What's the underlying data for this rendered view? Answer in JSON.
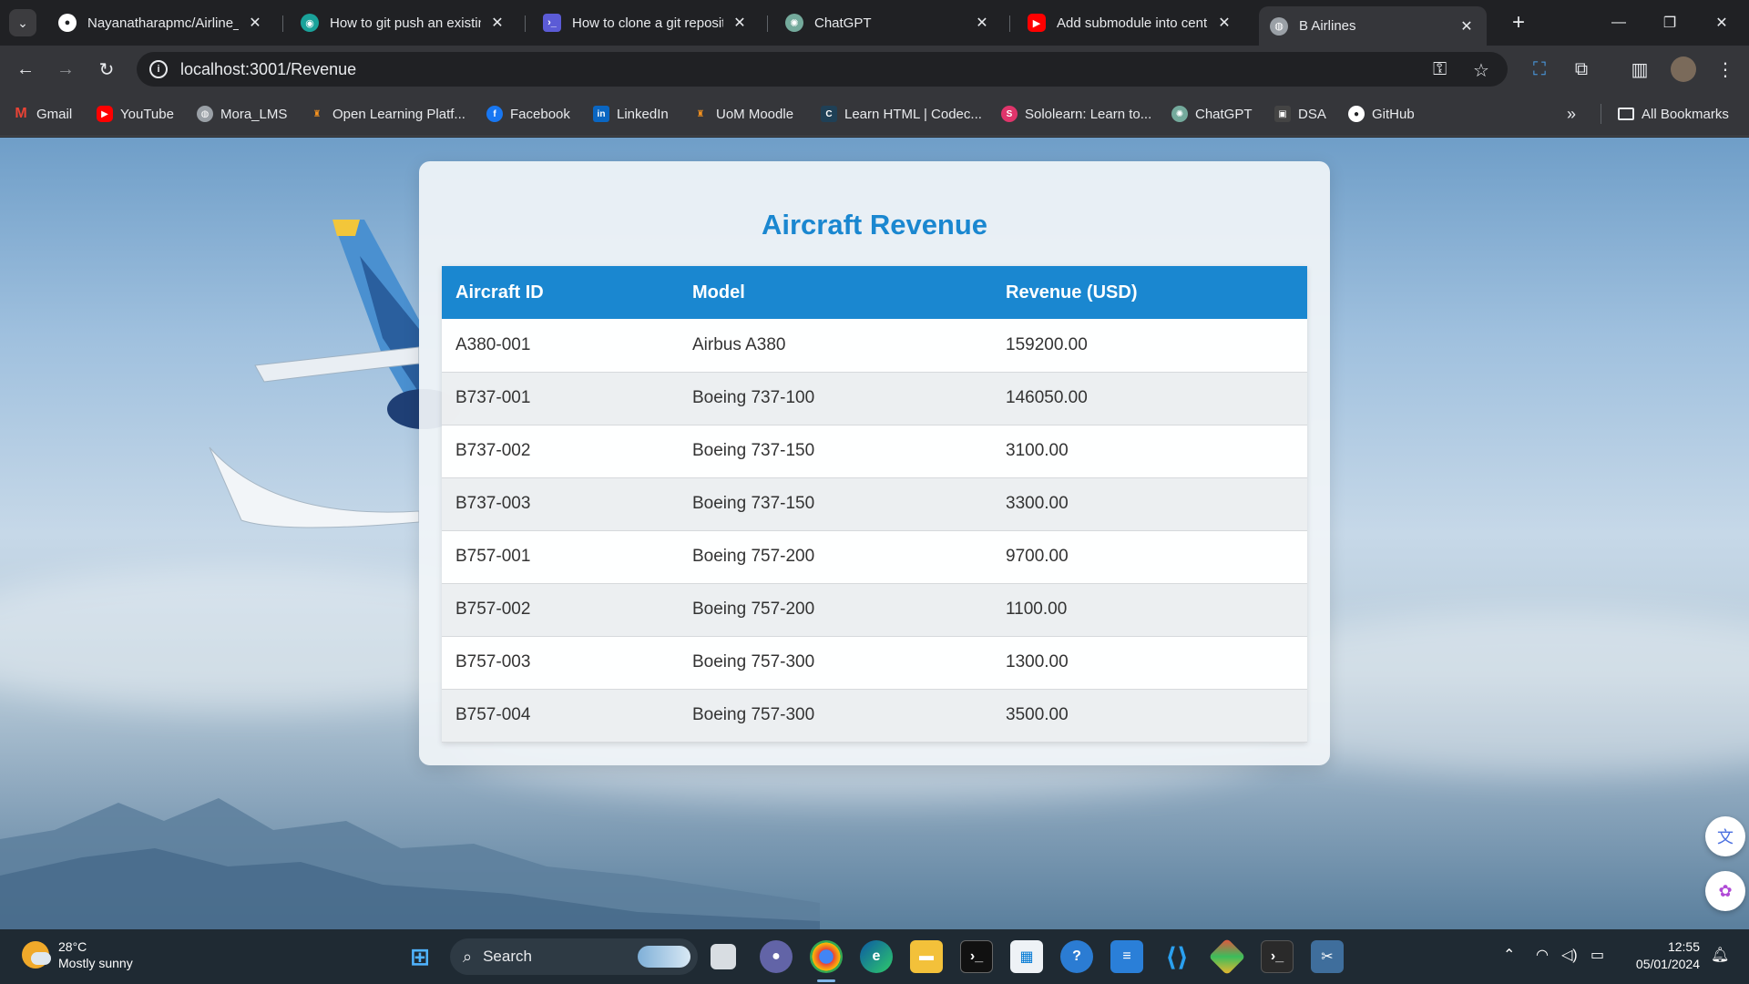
{
  "browser": {
    "tabs": [
      {
        "title": "Nayanatharapmc/Airline_R",
        "favicon": "github-icon",
        "active": false
      },
      {
        "title": "How to git push an existing",
        "favicon": "eye-icon",
        "active": false
      },
      {
        "title": "How to clone a git repository",
        "favicon": "terminal-icon",
        "active": false
      },
      {
        "title": "ChatGPT",
        "favicon": "chatgpt-icon",
        "active": false
      },
      {
        "title": "Add submodule into centr",
        "favicon": "youtube-icon",
        "active": false
      },
      {
        "title": "B Airlines",
        "favicon": "globe-icon",
        "active": true
      }
    ],
    "url": "localhost:3001/Revenue",
    "bookmarks": [
      {
        "label": "Gmail",
        "icon": "gmail-icon",
        "color": "#ea4335"
      },
      {
        "label": "YouTube",
        "icon": "youtube-icon",
        "color": "#ff0000"
      },
      {
        "label": "Mora_LMS",
        "icon": "globe-icon",
        "color": "#9aa0a6"
      },
      {
        "label": "Open Learning Platf...",
        "icon": "moodle-icon",
        "color": "#f7931e"
      },
      {
        "label": "Facebook",
        "icon": "facebook-icon",
        "color": "#1877f2"
      },
      {
        "label": "LinkedIn",
        "icon": "linkedin-icon",
        "color": "#0a66c2"
      },
      {
        "label": "UoM Moodle",
        "icon": "moodle-icon",
        "color": "#f7931e"
      },
      {
        "label": "Learn HTML | Codec...",
        "icon": "codecademy-icon",
        "color": "#1f4056"
      },
      {
        "label": "Sololearn: Learn to...",
        "icon": "sololearn-icon",
        "color": "#e0356b"
      },
      {
        "label": "ChatGPT",
        "icon": "chatgpt-icon",
        "color": "#74aa9c"
      },
      {
        "label": "DSA",
        "icon": "cube-icon",
        "color": "#444444"
      },
      {
        "label": "GitHub",
        "icon": "github-icon",
        "color": "#ffffff"
      }
    ],
    "all_bookmarks_label": "All Bookmarks",
    "more_glyph": "»"
  },
  "page": {
    "title": "Aircraft Revenue",
    "table": {
      "headers": [
        "Aircraft ID",
        "Model",
        "Revenue (USD)"
      ],
      "rows": [
        [
          "A380-001",
          "Airbus A380",
          "159200.00"
        ],
        [
          "B737-001",
          "Boeing 737-100",
          "146050.00"
        ],
        [
          "B737-002",
          "Boeing 737-150",
          "3100.00"
        ],
        [
          "B737-003",
          "Boeing 737-150",
          "3300.00"
        ],
        [
          "B757-001",
          "Boeing 757-200",
          "9700.00"
        ],
        [
          "B757-002",
          "Boeing 757-200",
          "1100.00"
        ],
        [
          "B757-003",
          "Boeing 757-300",
          "1300.00"
        ],
        [
          "B757-004",
          "Boeing 757-300",
          "3500.00"
        ]
      ]
    },
    "accent_color": "#1a87d0"
  },
  "taskbar": {
    "weather": {
      "temp": "28°C",
      "condition": "Mostly sunny"
    },
    "search_label": "Search",
    "time": "12:55",
    "date": "05/01/2024"
  }
}
